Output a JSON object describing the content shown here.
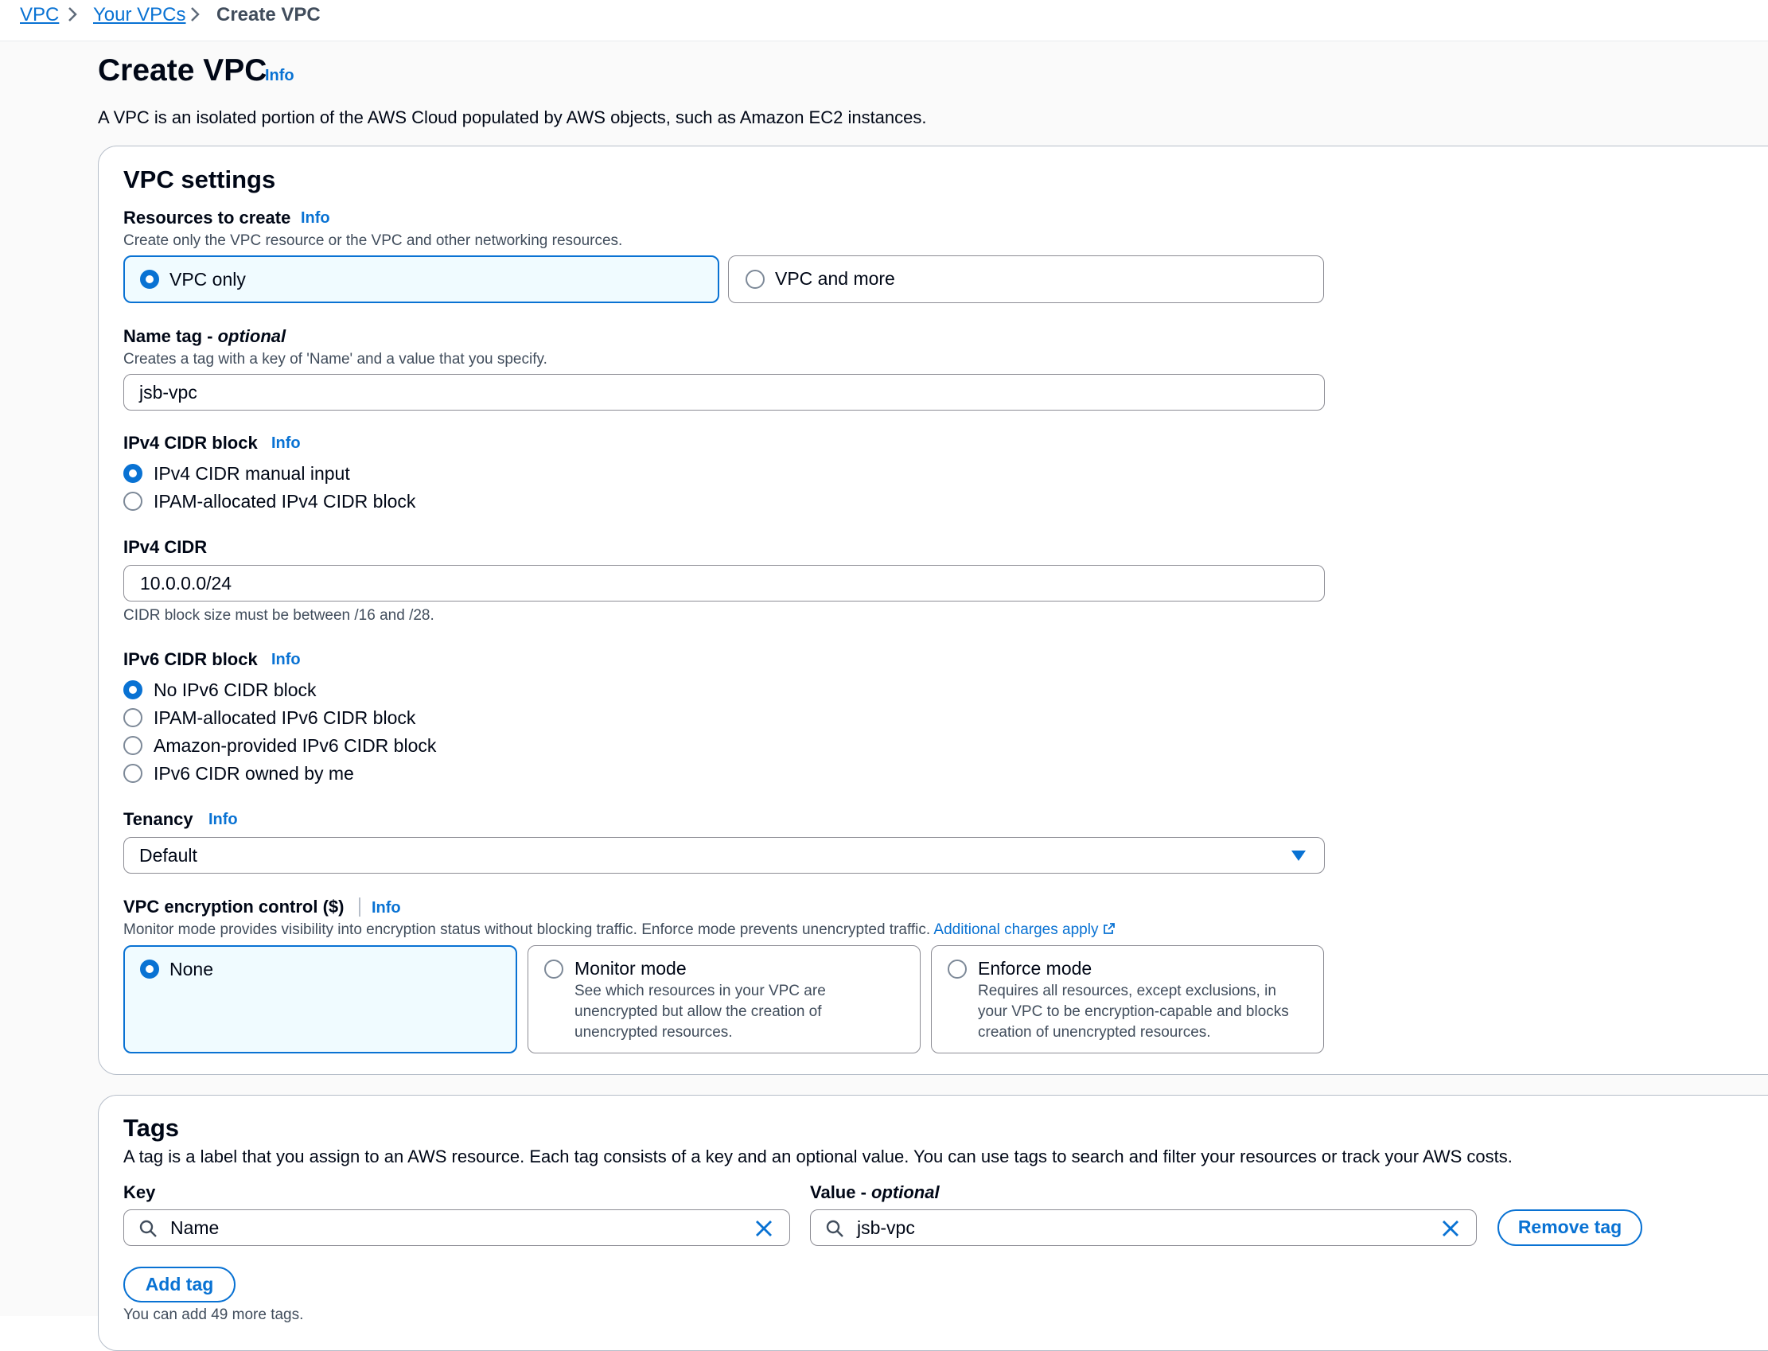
{
  "breadcrumb": {
    "items": [
      "VPC",
      "Your VPCs",
      "Create VPC"
    ]
  },
  "header": {
    "title": "Create VPC",
    "info": "Info",
    "description": "A VPC is an isolated portion of the AWS Cloud populated by AWS objects, such as Amazon EC2 instances."
  },
  "vpc_settings": {
    "heading": "VPC settings",
    "resources": {
      "label": "Resources to create",
      "info": "Info",
      "description": "Create only the VPC resource or the VPC and other networking resources.",
      "options": [
        "VPC only",
        "VPC and more"
      ],
      "selected": "VPC only"
    },
    "name_tag": {
      "label": "Name tag - ",
      "label_optional": "optional",
      "description": "Creates a tag with a key of 'Name' and a value that you specify.",
      "value": "jsb-vpc"
    },
    "ipv4_block": {
      "label": "IPv4 CIDR block",
      "info": "Info",
      "options": [
        "IPv4 CIDR manual input",
        "IPAM-allocated IPv4 CIDR block"
      ],
      "selected": "IPv4 CIDR manual input"
    },
    "ipv4_cidr": {
      "label": "IPv4 CIDR",
      "value": "10.0.0.0/24",
      "hint": "CIDR block size must be between /16 and /28."
    },
    "ipv6_block": {
      "label": "IPv6 CIDR block",
      "info": "Info",
      "options": [
        "No IPv6 CIDR block",
        "IPAM-allocated IPv6 CIDR block",
        "Amazon-provided IPv6 CIDR block",
        "IPv6 CIDR owned by me"
      ],
      "selected": "No IPv6 CIDR block"
    },
    "tenancy": {
      "label": "Tenancy",
      "info": "Info",
      "value": "Default"
    },
    "encryption": {
      "label": "VPC encryption control ($)",
      "info": "Info",
      "description": "Monitor mode provides visibility into encryption status without blocking traffic. Enforce mode prevents unencrypted traffic.",
      "charges_link": "Additional charges apply",
      "options": [
        {
          "label": "None",
          "description": ""
        },
        {
          "label": "Monitor mode",
          "description": "See which resources in your VPC are unencrypted but allow the creation of unencrypted resources."
        },
        {
          "label": "Enforce mode",
          "description": "Requires all resources, except exclusions, in your VPC to be encryption-capable and blocks creation of unencrypted resources."
        }
      ],
      "selected": "None"
    }
  },
  "tags": {
    "heading": "Tags",
    "description": "A tag is a label that you assign to an AWS resource. Each tag consists of a key and an optional value. You can use tags to search and filter your resources or track your AWS costs.",
    "key_label": "Key",
    "value_label": "Value - ",
    "value_label_optional": "optional",
    "rows": [
      {
        "key": "Name",
        "value": "jsb-vpc"
      }
    ],
    "remove_label": "Remove tag",
    "add_label": "Add tag",
    "footer": "You can add 49 more tags."
  },
  "colors": {
    "accent": "#0972d3",
    "selected_tile_bg": "#f0fbff",
    "text": "#000716",
    "secondary_text": "#414d5c",
    "border": "#8c8c94"
  }
}
